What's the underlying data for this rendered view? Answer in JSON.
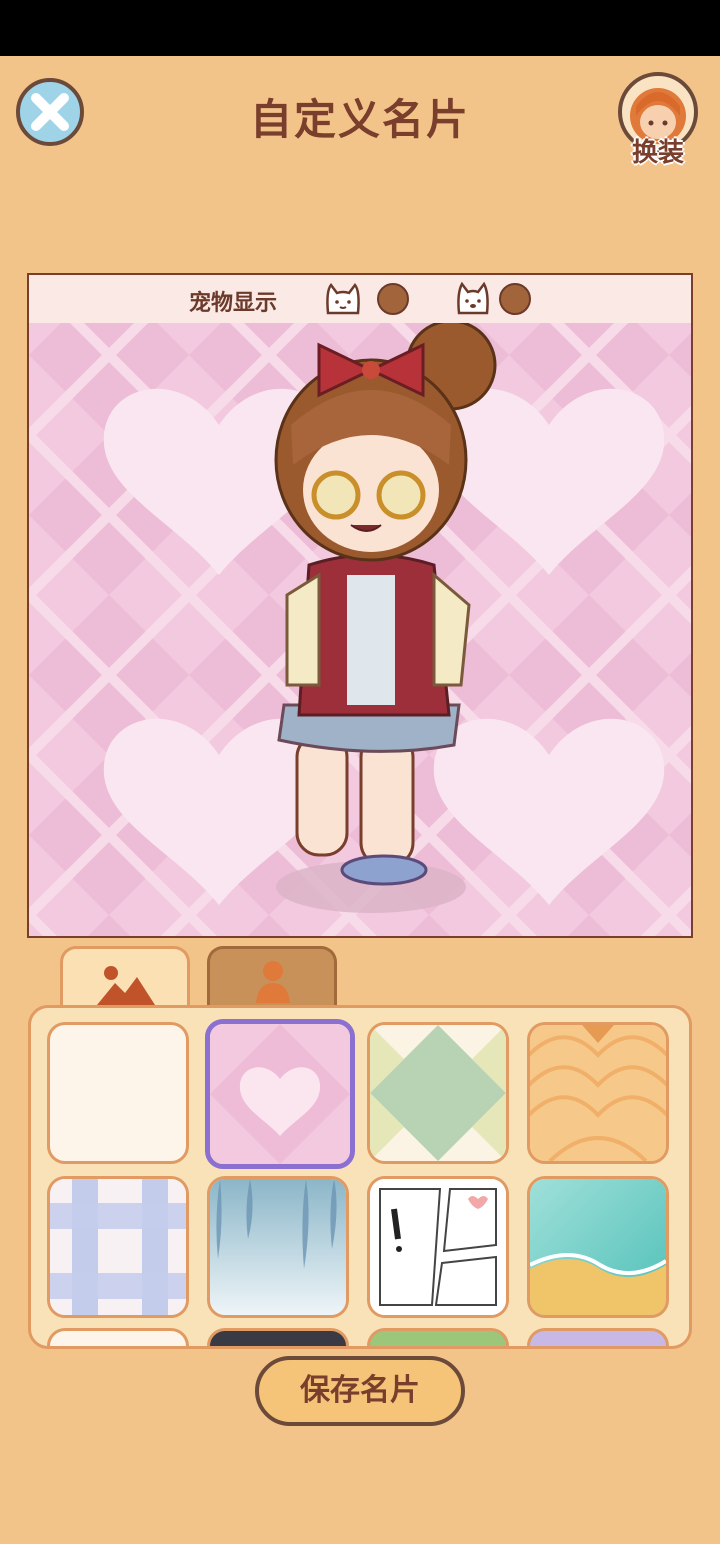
{
  "header": {
    "title": "自定义名片",
    "outfit_label": "换装"
  },
  "preview": {
    "pet_display_label": "宠物显示"
  },
  "tabs": [
    {
      "name": "background",
      "icon": "landscape-icon",
      "active": true
    },
    {
      "name": "character",
      "icon": "person-icon",
      "active": false
    }
  ],
  "backgrounds": {
    "selected_index": 1,
    "items": [
      "plain-cream",
      "pink-hearts",
      "green-argyle",
      "orange-scales",
      "blue-plaid",
      "leafy-blue",
      "manga-panels",
      "beach-shore"
    ]
  },
  "actions": {
    "save_label": "保存名片"
  },
  "colors": {
    "background": "#f3c48a",
    "title_text": "#7a3e2c",
    "selected_outline": "#8b6fd1",
    "pet_toggle": "#a2643a"
  }
}
